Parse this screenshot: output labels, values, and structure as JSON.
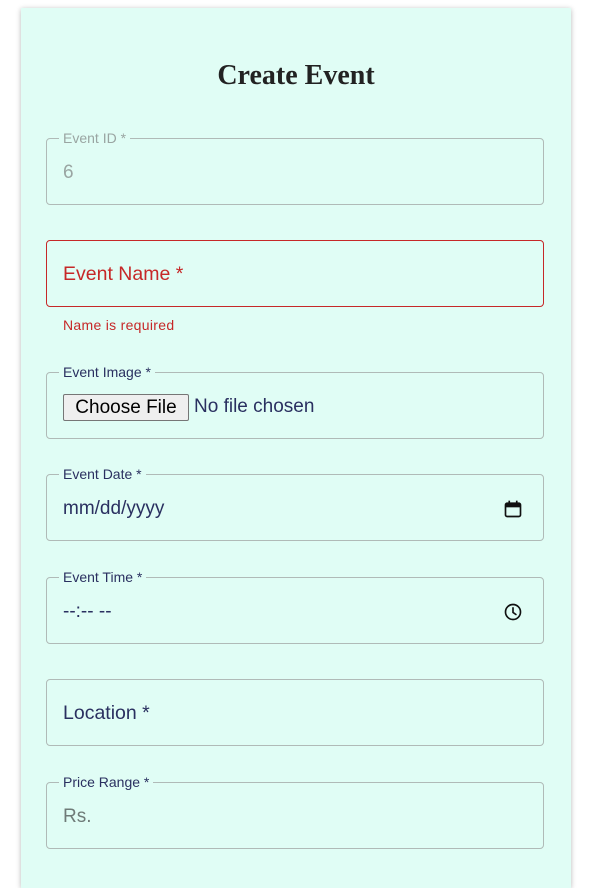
{
  "form": {
    "title": "Create Event",
    "event_id": {
      "label": "Event ID *",
      "value": "6"
    },
    "event_name": {
      "label": "Event Name *",
      "error": "Name is required"
    },
    "event_image": {
      "label": "Event Image *",
      "button": "Choose File",
      "status": "No file chosen"
    },
    "event_date": {
      "label": "Event Date *",
      "value": "mm/dd/yyyy",
      "icon": "calendar-icon"
    },
    "event_time": {
      "label": "Event Time *",
      "value": "--:-- --",
      "icon": "clock-icon"
    },
    "location": {
      "label": "Location *"
    },
    "price_range": {
      "label": "Price Range *",
      "placeholder": "Rs."
    }
  },
  "colors": {
    "card_background": "#e0fdf5",
    "error": "#c62828",
    "text": "#2a3060",
    "border": "#b0bab7"
  }
}
